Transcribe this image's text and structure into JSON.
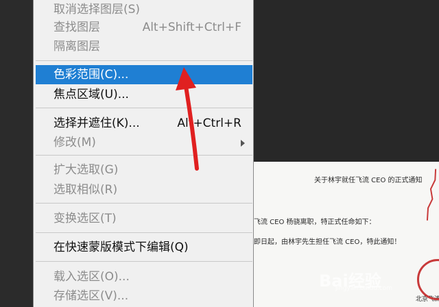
{
  "menu": {
    "items": [
      {
        "label": "取消选择图层(S)",
        "shortcut": "",
        "disabled": true
      },
      {
        "label": "查找图层",
        "shortcut": "Alt+Shift+Ctrl+F",
        "disabled": true
      },
      {
        "label": "隔离图层",
        "shortcut": "",
        "disabled": true
      },
      {
        "label": "色彩范围(C)...",
        "shortcut": "",
        "disabled": false,
        "highlighted": true
      },
      {
        "label": "焦点区域(U)...",
        "shortcut": "",
        "disabled": false
      },
      {
        "label": "选择并遮住(K)...",
        "shortcut": "Alt+Ctrl+R",
        "disabled": false
      },
      {
        "label": "修改(M)",
        "shortcut": "",
        "disabled": true,
        "submenu": true
      },
      {
        "label": "扩大选取(G)",
        "shortcut": "",
        "disabled": true
      },
      {
        "label": "选取相似(R)",
        "shortcut": "",
        "disabled": true
      },
      {
        "label": "变换选区(T)",
        "shortcut": "",
        "disabled": true
      },
      {
        "label": "在快速蒙版模式下编辑(Q)",
        "shortcut": "",
        "disabled": false
      },
      {
        "label": "载入选区(O)...",
        "shortcut": "",
        "disabled": true
      },
      {
        "label": "存储选区(V)...",
        "shortcut": "",
        "disabled": true
      }
    ]
  },
  "document": {
    "title": "关于林宇就任飞流 CEO 的正式通知",
    "line1": "飞流 CEO 杨骁离职，特正式任命如下：",
    "line2": "即日起，由林宇先生担任飞流 CEO，特此通知！",
    "signature": "北京飞流"
  },
  "watermark": {
    "brand": "Bai经验",
    "url": "jingyan.baidu.com"
  },
  "colors": {
    "highlight": "#1f7fd3",
    "annotation_arrow": "#e02020",
    "seal": "#c83a3a"
  }
}
